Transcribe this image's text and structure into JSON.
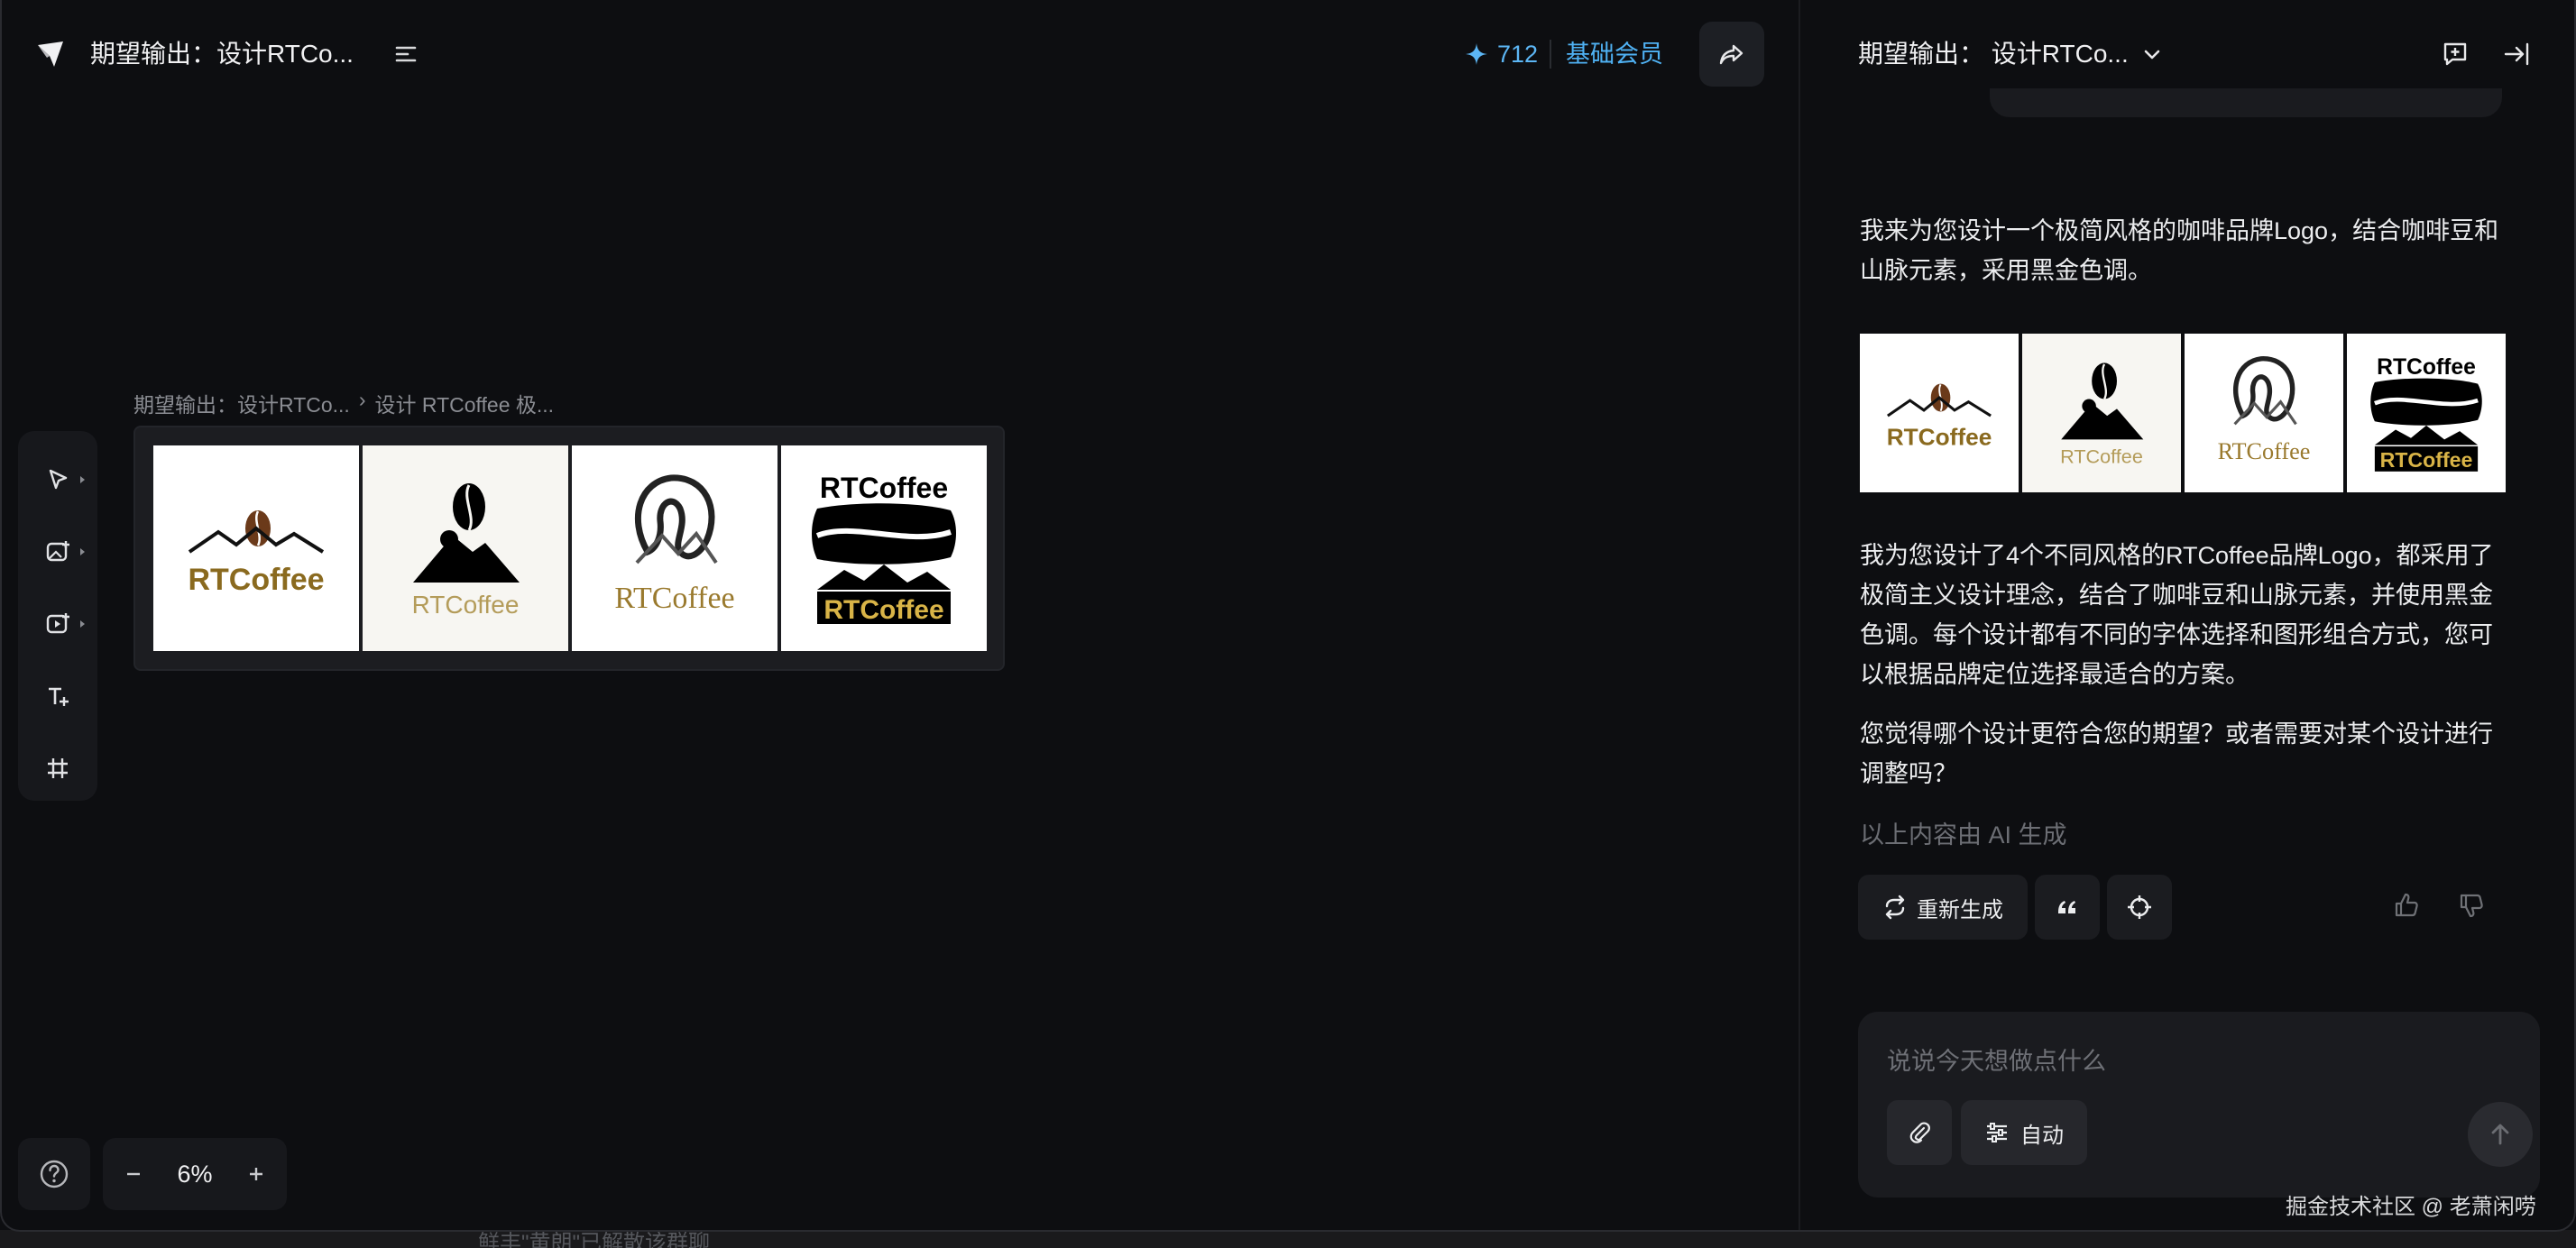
{
  "topbar": {
    "project_title": "期望输出：设计RTCo...",
    "credits": "712",
    "membership": "基础会员"
  },
  "canvas": {
    "breadcrumb": {
      "parent": "期望输出：设计RTCo...",
      "separator": "›",
      "current": "设计 RTCoffee 极..."
    },
    "logos": [
      {
        "text": "RTCoffee",
        "style": "bean-mountain-gold"
      },
      {
        "text": "RTCoffee",
        "style": "bean-peak-black"
      },
      {
        "text": "RTCoffee",
        "style": "serif-bean-gold"
      },
      {
        "text_top": "RTCoffee",
        "text_bottom": "RTCoffee",
        "style": "black-badge"
      }
    ],
    "zoom": "6%"
  },
  "chat": {
    "title": "期望输出：  设计RTCo...",
    "messages": {
      "intro": "我来为您设计一个极简风格的咖啡品牌Logo，结合咖啡豆和山脉元素，采用黑金色调。",
      "body": "我为您设计了4个不同风格的RTCoffee品牌Logo，都采用了极简主义设计理念，结合了咖啡豆和山脉元素，并使用黑金色调。每个设计都有不同的字体选择和图形组合方式，您可以根据品牌定位选择最适合的方案。",
      "question": "您觉得哪个设计更符合您的期望？或者需要对某个设计进行调整吗？"
    },
    "ai_notice": "以上内容由 AI 生成",
    "actions": {
      "regenerate": "重新生成"
    },
    "composer": {
      "placeholder": "说说今天想做点什么",
      "mode": "自动"
    }
  },
  "watermark": "掘金技术社区 @ 老萧闲唠",
  "background_strip": "鲜丰\"黄朗\"已解散该群聊",
  "colors": {
    "accent_blue": "#4fb1f3",
    "gold": "#8a6a1f",
    "coffee_brown": "#6b3a1a"
  }
}
